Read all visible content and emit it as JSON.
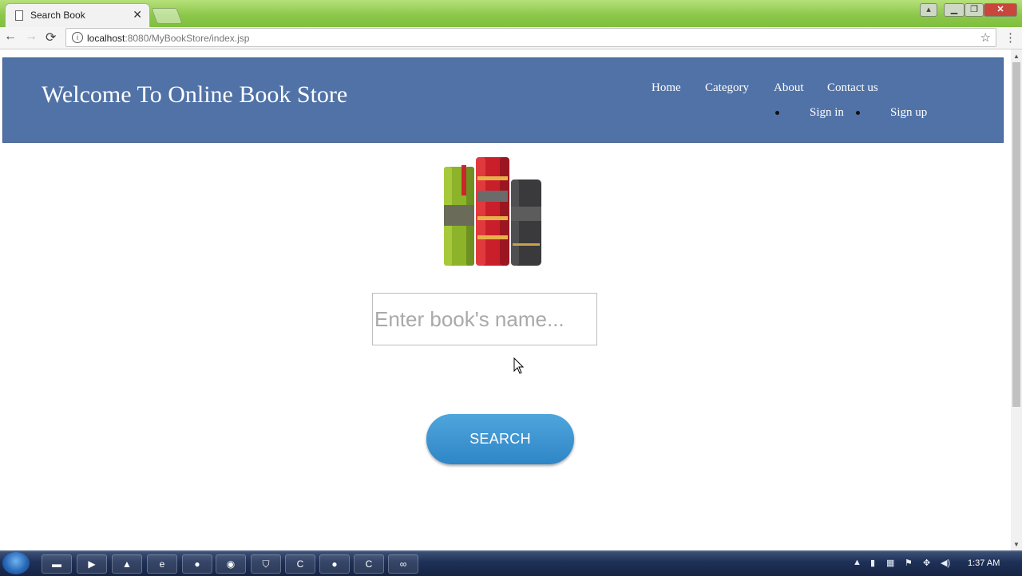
{
  "browser": {
    "tab_title": "Search Book",
    "tab_close": "✕",
    "url_host": "localhost",
    "url_path": ":8080/MyBookStore/index.jsp",
    "back_icon": "←",
    "forward_icon": "→",
    "reload_icon": "⟳",
    "star_icon": "☆",
    "menu_icon": "⋮",
    "window_controls": {
      "minimize": "▁",
      "maximize": "❐",
      "close": "✕"
    }
  },
  "header": {
    "site_title": "Welcome To Online Book Store",
    "nav": {
      "home": "Home",
      "category": "Category",
      "about": "About",
      "contact": "Contact us",
      "sign_in": "Sign in",
      "sign_up": "Sign up"
    },
    "background_color": "#5072a7"
  },
  "search": {
    "placeholder": "Enter book's name...",
    "value": "",
    "button_label": "SEARCH",
    "button_color": "#3a93d2"
  },
  "taskbar": {
    "clock": "1:37 AM",
    "icons": [
      "folder-icon",
      "media-player-icon",
      "vlc-icon",
      "ie-icon",
      "chrome-icon",
      "firefox-icon",
      "shield-icon",
      "green-app-icon",
      "chrome-icon",
      "c-app-icon",
      "vs-icon"
    ]
  }
}
